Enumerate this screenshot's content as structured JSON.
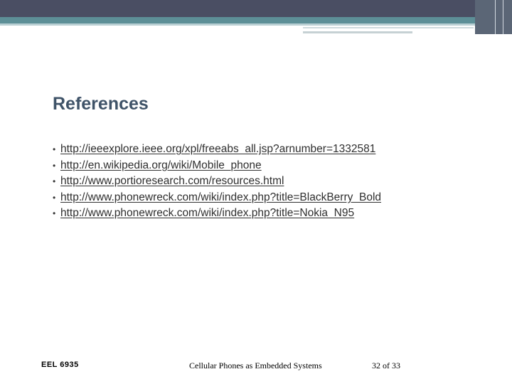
{
  "slide": {
    "title": "References",
    "references": [
      {
        "bullet": "•",
        "url": "http://ieeexplore.ieee.org/xpl/freeabs_all.jsp?arnumber=1332581"
      },
      {
        "bullet": "•",
        "url": "http://en.wikipedia.org/wiki/Mobile_phone"
      },
      {
        "bullet": "•",
        "url": "http://www.portioresearch.com/resources.html"
      },
      {
        "bullet": "•",
        "url": "http://www.phonewreck.com/wiki/index.php?title=BlackBerry_Bold"
      },
      {
        "bullet": "•",
        "url": "http://www.phonewreck.com/wiki/index.php?title=Nokia_N95"
      }
    ]
  },
  "footer": {
    "course": "EEL 6935",
    "topic": "Cellular Phones as Embedded Systems",
    "page": "32 of 33"
  },
  "colors": {
    "banner_dark": "#4a4e63",
    "banner_teal": "#5d8f97",
    "title": "#3f5368"
  }
}
